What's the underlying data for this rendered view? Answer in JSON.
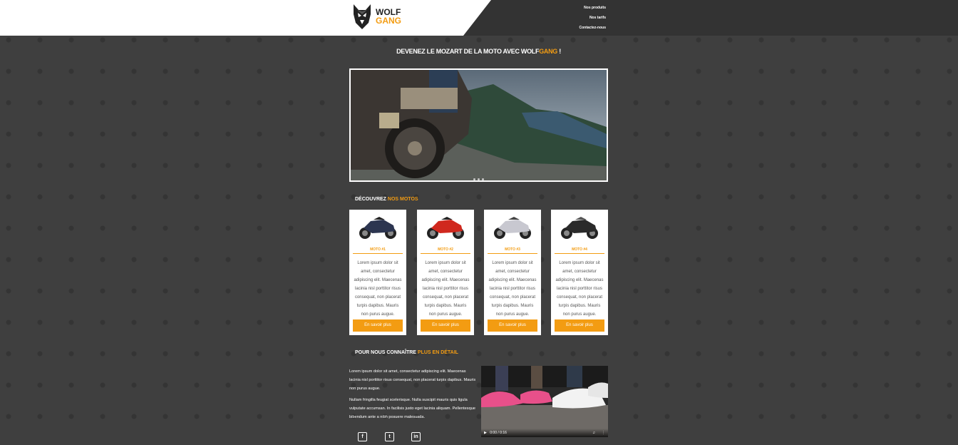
{
  "brand": {
    "word1": "WOLF",
    "word2": "GANG"
  },
  "nav": {
    "items": [
      "Nos produits",
      "Nos tarifs",
      "Contactez-nous"
    ]
  },
  "hero": {
    "title_before": "Devenez le Mozart de la moto avec Wolf",
    "title_accent": "Gang",
    "title_after": " !"
  },
  "products": {
    "heading_before": "Découvrez ",
    "heading_accent": "nos motos",
    "items": [
      {
        "title": "Moto #1",
        "text": "Lorem ipsum dolor sit amet, consectetur adipiscing elit. Maecenas lacinia nisl porttitor risus consequat, non placerat turpis dapibus. Mauris non purus augue.",
        "button": "En savoir plus",
        "color": "#2c3550"
      },
      {
        "title": "Moto #2",
        "text": "Lorem ipsum dolor sit amet, consectetur adipiscing elit. Maecenas lacinia nisl porttitor risus consequat, non placerat turpis dapibus. Mauris non purus augue.",
        "button": "En savoir plus",
        "color": "#d0281e"
      },
      {
        "title": "Moto #3",
        "text": "Lorem ipsum dolor sit amet, consectetur adipiscing elit. Maecenas lacinia nisl porttitor risus consequat, non placerat turpis dapibus. Mauris non purus augue.",
        "button": "En savoir plus",
        "color": "#c8c8d0"
      },
      {
        "title": "Moto #4",
        "text": "Lorem ipsum dolor sit amet, consectetur adipiscing elit. Maecenas lacinia nisl porttitor risus consequat, non placerat turpis dapibus. Mauris non purus augue.",
        "button": "En savoir plus",
        "color": "#2a2a2a"
      }
    ]
  },
  "about": {
    "heading_before": "Pour nous connaître ",
    "heading_accent": "plus en détail",
    "p1": "Lorem ipsum dolor sit amet, consectetur adipiscing elit. Maecenas lacinia nisl porttitor risus consequat, non placerat turpis dapibus. Mauris non purus augue.",
    "p2": "Nullam fringilla feugiat scelerisque. Nulla suscipit mauris quis ligula vulputate accumsan. In facilisis justo eget lacinia aliquam. Pellentesque bibendum ante a nibh posuere malesuada."
  },
  "video": {
    "time": "0:00 / 0:16"
  },
  "colors": {
    "accent": "#f39c12",
    "background": "#3f3f3f",
    "header_dark": "#333333"
  },
  "icons": [
    "facebook-icon",
    "twitter-icon",
    "linkedin-icon"
  ]
}
